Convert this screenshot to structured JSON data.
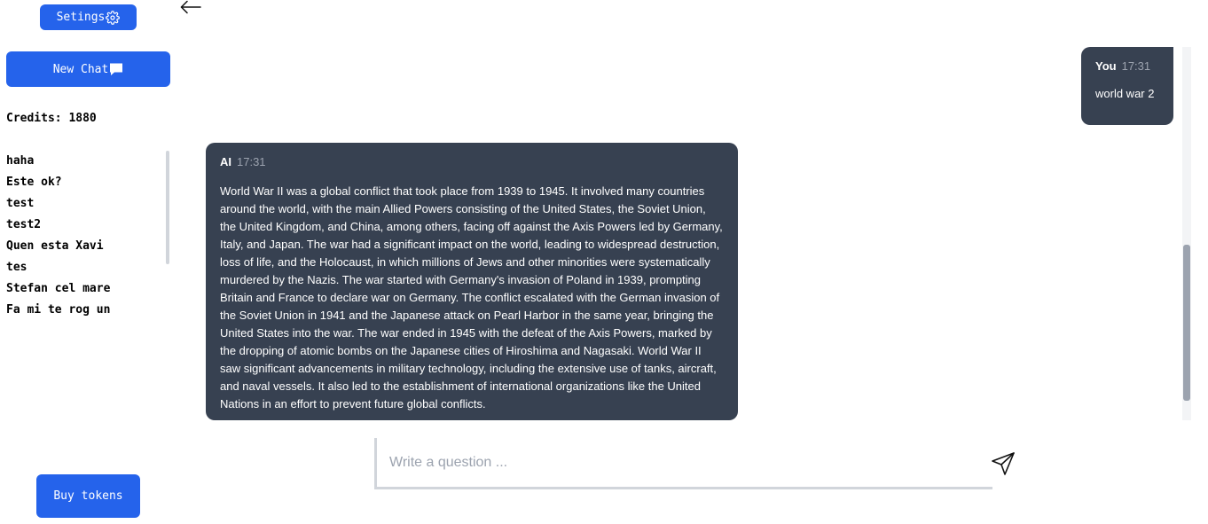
{
  "sidebar": {
    "settings_label": "Setings",
    "new_chat_label": "New Chat",
    "credits": "Credits: 1880",
    "chats": [
      "haha",
      "Este ok?",
      "test",
      "test2",
      "Quen esta Xavi",
      "tes",
      "Stefan cel mare",
      "Fa mi te rog un"
    ],
    "buy_tokens_label": "Buy tokens"
  },
  "messages": {
    "user": {
      "author": "You",
      "time": "17:31",
      "text": "world war 2"
    },
    "ai": {
      "author": "AI",
      "time": "17:31",
      "text": "World War II was a global conflict that took place from 1939 to 1945. It involved many countries around the world, with the main Allied Powers consisting of the United States, the Soviet Union, the United Kingdom, and China, among others, facing off against the Axis Powers led by Germany, Italy, and Japan. The war had a significant impact on the world, leading to widespread destruction, loss of life, and the Holocaust, in which millions of Jews and other minorities were systematically murdered by the Nazis. The war started with Germany's invasion of Poland in 1939, prompting Britain and France to declare war on Germany. The conflict escalated with the German invasion of the Soviet Union in 1941 and the Japanese attack on Pearl Harbor in the same year, bringing the United States into the war. The war ended in 1945 with the defeat of the Axis Powers, marked by the dropping of atomic bombs on the Japanese cities of Hiroshima and Nagasaki. World War II saw significant advancements in military technology, including the extensive use of tanks, aircraft, and naval vessels. It also led to the establishment of international organizations like the United Nations in an effort to prevent future global conflicts."
    }
  },
  "composer": {
    "placeholder": "Write a question ..."
  },
  "icons": {
    "settings": "gear-icon",
    "new_chat": "chat-bubble-icon",
    "back": "arrow-left-icon",
    "send": "paper-plane-icon"
  },
  "colors": {
    "accent": "#2563eb",
    "bubble": "#374151",
    "timestamp": "#9ca3af"
  }
}
